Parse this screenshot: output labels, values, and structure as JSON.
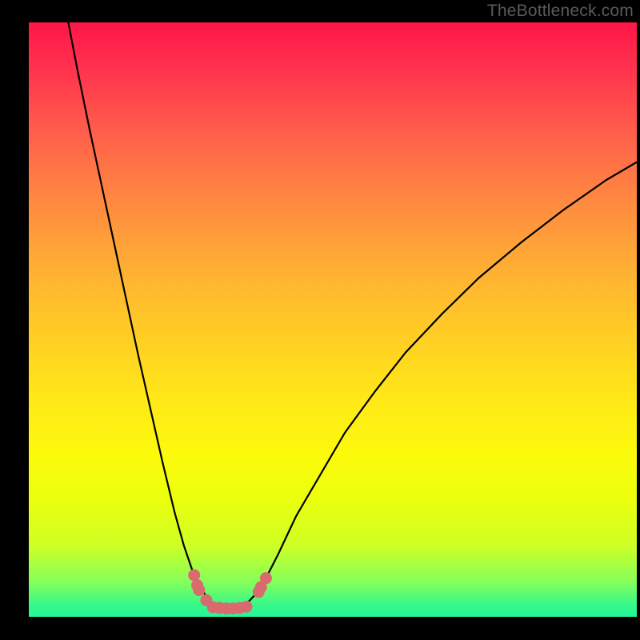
{
  "watermark": "TheBottleneck.com",
  "chart_data": {
    "type": "line",
    "title": "",
    "xlabel": "",
    "ylabel": "",
    "xlim": [
      0,
      100
    ],
    "ylim": [
      0,
      100
    ],
    "curve": [
      {
        "x": 6.5,
        "y": 100
      },
      {
        "x": 8.0,
        "y": 92
      },
      {
        "x": 10.0,
        "y": 82
      },
      {
        "x": 12.0,
        "y": 72.5
      },
      {
        "x": 14.0,
        "y": 63
      },
      {
        "x": 16.0,
        "y": 53.5
      },
      {
        "x": 18.0,
        "y": 44
      },
      {
        "x": 20.0,
        "y": 35
      },
      {
        "x": 22.0,
        "y": 26
      },
      {
        "x": 24.0,
        "y": 17.5
      },
      {
        "x": 25.5,
        "y": 12
      },
      {
        "x": 27.0,
        "y": 7.5
      },
      {
        "x": 28.5,
        "y": 4.5
      },
      {
        "x": 29.5,
        "y": 3.0
      },
      {
        "x": 30.5,
        "y": 2.1
      },
      {
        "x": 31.5,
        "y": 1.6
      },
      {
        "x": 32.5,
        "y": 1.4
      },
      {
        "x": 33.5,
        "y": 1.4
      },
      {
        "x": 34.5,
        "y": 1.6
      },
      {
        "x": 36.0,
        "y": 2.4
      },
      {
        "x": 37.5,
        "y": 4.0
      },
      {
        "x": 39.0,
        "y": 6.5
      },
      {
        "x": 41.0,
        "y": 10.5
      },
      {
        "x": 44.0,
        "y": 17
      },
      {
        "x": 48.0,
        "y": 24
      },
      {
        "x": 52.0,
        "y": 31
      },
      {
        "x": 57.0,
        "y": 38
      },
      {
        "x": 62.0,
        "y": 44.5
      },
      {
        "x": 68.0,
        "y": 51
      },
      {
        "x": 74.0,
        "y": 57
      },
      {
        "x": 81.0,
        "y": 63
      },
      {
        "x": 88.0,
        "y": 68.5
      },
      {
        "x": 95.0,
        "y": 73.5
      },
      {
        "x": 100.0,
        "y": 76.5
      }
    ],
    "dots": [
      {
        "x": 27.2,
        "y": 7.0
      },
      {
        "x": 27.7,
        "y": 5.3
      },
      {
        "x": 28.0,
        "y": 4.5
      },
      {
        "x": 29.2,
        "y": 2.8
      },
      {
        "x": 30.3,
        "y": 1.6
      },
      {
        "x": 31.4,
        "y": 1.5
      },
      {
        "x": 32.5,
        "y": 1.4
      },
      {
        "x": 33.6,
        "y": 1.4
      },
      {
        "x": 34.7,
        "y": 1.5
      },
      {
        "x": 35.8,
        "y": 1.7
      },
      {
        "x": 37.8,
        "y": 4.2
      },
      {
        "x": 38.2,
        "y": 5.0
      },
      {
        "x": 39.0,
        "y": 6.5
      }
    ],
    "colors": {
      "gradient_top": "#ff1648",
      "gradient_bottom": "#23f79b",
      "curve": "#000000",
      "dots": "#d96a6e",
      "frame": "#000000"
    }
  }
}
